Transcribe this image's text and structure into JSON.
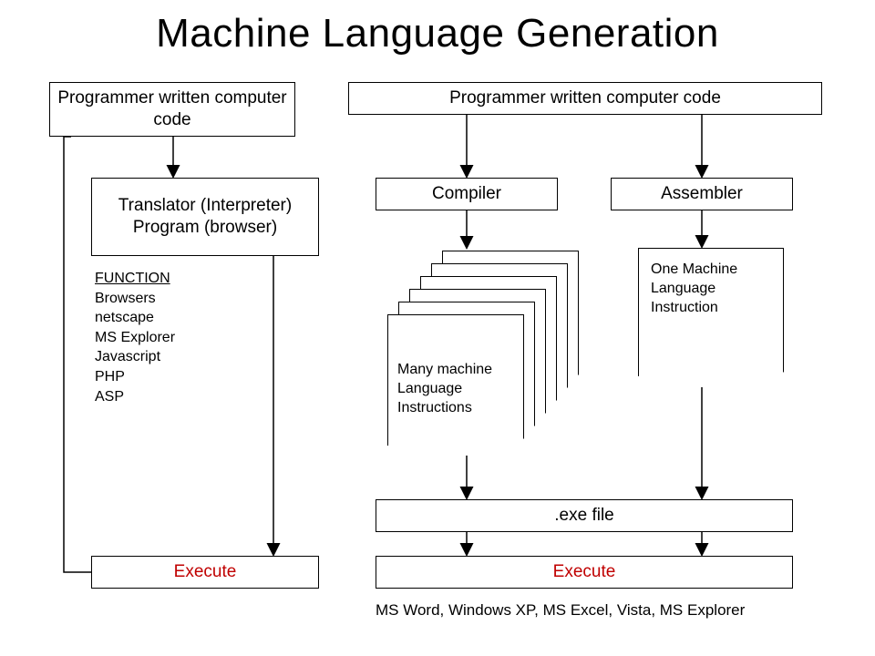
{
  "title": "Machine Language Generation",
  "left": {
    "source": "Programmer written computer code",
    "translator": "Translator (Interpreter) Program (browser)",
    "function_header": "FUNCTION",
    "function_items": [
      "Browsers",
      "netscape",
      "MS Explorer",
      "Javascript",
      "PHP",
      "ASP"
    ],
    "execute": "Execute"
  },
  "right": {
    "source": "Programmer written computer code",
    "compiler": "Compiler",
    "assembler": "Assembler",
    "many_instr": "Many machine Language Instructions",
    "one_instr": "One Machine Language Instruction",
    "exe": ".exe file",
    "execute": "Execute",
    "caption": "MS Word, Windows XP, MS Excel, Vista, MS Explorer"
  }
}
